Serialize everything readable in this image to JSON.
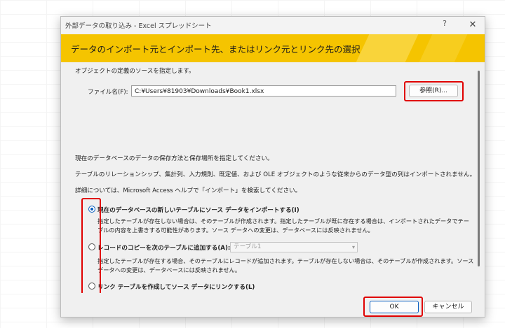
{
  "window": {
    "title": "外部データの取り込み - Excel スプレッドシート",
    "help_glyph": "?",
    "close_glyph": "✕"
  },
  "banner": {
    "text": "データのインポート元とインポート先、またはリンク元とリンク先の選択"
  },
  "source": {
    "instruction": "オブジェクトの定義のソースを指定します。",
    "file_label": "ファイル名(F):",
    "file_value": "C:¥Users¥81903¥Downloads¥Book1.xlsx",
    "browse_label": "参照(R)..."
  },
  "storage": {
    "instruction": "現在のデータベースのデータの保存方法と保存場所を指定してください。",
    "note": "テーブルのリレーションシップ、集計列、入力規則、既定値、および OLE オブジェクトのような従来からのデータ型の列はインポートされません。",
    "help_hint": "詳細については、Microsoft Access ヘルプで「インポート」を検索してください。"
  },
  "options": [
    {
      "label": "現在のデータベースの新しいテーブルにソース データをインポートする(I)",
      "checked": true,
      "desc_lines": [
        "指定したテーブルが存在しない場合は、そのテーブルが作成されます。指定したテーブルが既に存在する場合は、インポートされたデータでテー",
        "ブルの内容を上書きする可能性があります。ソース データへの変更は、データベースには反映されません。"
      ]
    },
    {
      "label": "レコードのコピーを次のテーブルに追加する(A):",
      "checked": false,
      "select_value": "テーブル1",
      "desc_lines": [
        "指定したテーブルが存在する場合、そのテーブルにレコードが追加されます。テーブルが存在しない場合は、そのテーブルが作成されます。ソース",
        "データへの変更は、データベースには反映されません。"
      ]
    },
    {
      "label": "リンク テーブルを作成してソース データにリンクする(L)",
      "checked": false
    }
  ],
  "footer": {
    "ok_label": "OK",
    "cancel_label": "キャンセル"
  },
  "colors": {
    "banner": "#f5c400",
    "highlight": "#e00000",
    "radio_selected": "#0a5fc0"
  }
}
